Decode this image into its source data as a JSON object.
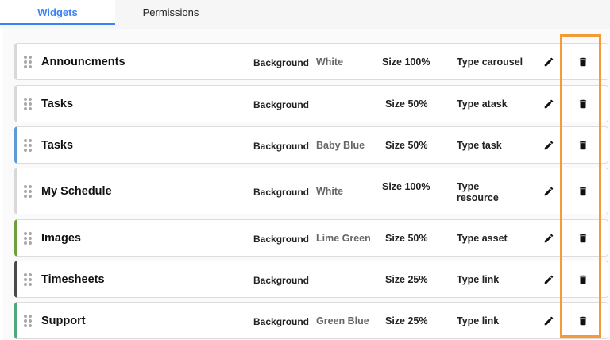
{
  "tabs": [
    {
      "label": "Widgets",
      "active": true
    },
    {
      "label": "Permissions",
      "active": false
    }
  ],
  "widgets": [
    {
      "name": "Announcments",
      "background_label": "Background",
      "background": "White",
      "size": "Size 100%",
      "type": "Type carousel",
      "accent": "#d8d8d8"
    },
    {
      "name": "Tasks",
      "background_label": "Background",
      "background": "",
      "size": "Size 50%",
      "type": "Type atask",
      "accent": "#d8d8d8"
    },
    {
      "name": "Tasks",
      "background_label": "Background",
      "background": "Baby Blue",
      "size": "Size 50%",
      "type": "Type task",
      "accent": "#5b9bd5"
    },
    {
      "name": "My Schedule",
      "background_label": "Background",
      "background": "White",
      "size": "Size 100%",
      "type": "Type resource",
      "accent": "#d8d8d8"
    },
    {
      "name": "Images",
      "background_label": "Background",
      "background": "Lime Green",
      "size": "Size 50%",
      "type": "Type asset",
      "accent": "#6f9e3f"
    },
    {
      "name": "Timesheets",
      "background_label": "Background",
      "background": "",
      "size": "Size 25%",
      "type": "Type link",
      "accent": "#4a4a4a"
    },
    {
      "name": "Support",
      "background_label": "Background",
      "background": "Green Blue",
      "size": "Size 25%",
      "type": "Type link",
      "accent": "#4ea87a"
    }
  ],
  "icons": {
    "drag": "drag-handle-icon",
    "edit": "pencil-icon",
    "delete": "trash-icon"
  },
  "colors": {
    "active_tab": "#3a82f7",
    "highlight": "#f49b37"
  }
}
